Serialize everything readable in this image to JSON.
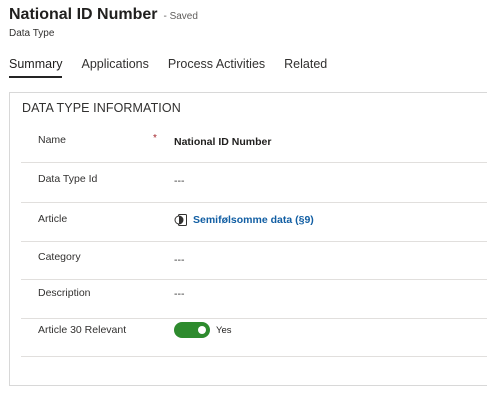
{
  "header": {
    "record_title": "National ID Number",
    "save_status": "- Saved",
    "entity_type": "Data Type"
  },
  "tabs": [
    {
      "label": "Summary",
      "active": true
    },
    {
      "label": "Applications",
      "active": false
    },
    {
      "label": "Process Activities",
      "active": false
    },
    {
      "label": "Related",
      "active": false
    }
  ],
  "section": {
    "title": "DATA TYPE INFORMATION",
    "fields": {
      "name": {
        "label": "Name",
        "required_mark": "*",
        "value": "National ID Number"
      },
      "data_type_id": {
        "label": "Data Type Id",
        "value": "---"
      },
      "article": {
        "label": "Article",
        "value": "Semifølsomme data (§9)",
        "icon": "record-link-icon"
      },
      "category": {
        "label": "Category",
        "value": "---"
      },
      "description": {
        "label": "Description",
        "value": "---"
      },
      "article_30": {
        "label": "Article 30 Relevant",
        "value": "Yes",
        "toggle_on": true
      }
    }
  },
  "colors": {
    "accent_link": "#115ea3",
    "toggle_on": "#2e8b2e",
    "required": "#a4262c"
  }
}
